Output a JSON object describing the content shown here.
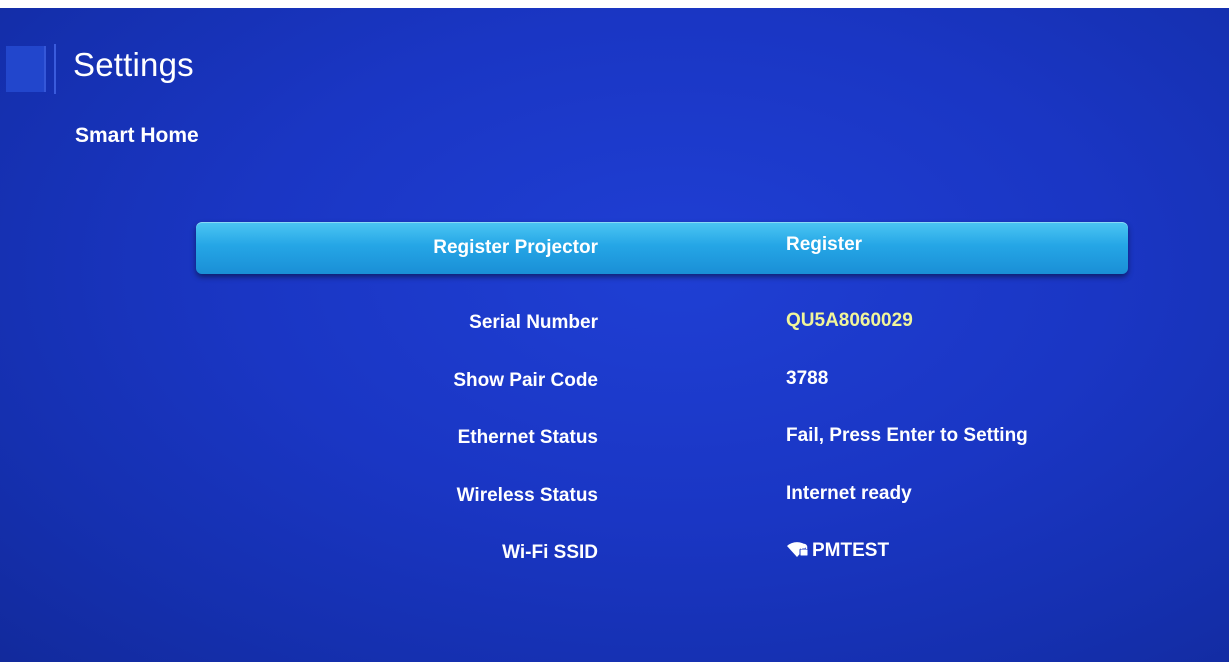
{
  "header": {
    "title": "Settings",
    "subtitle": "Smart Home"
  },
  "rows": [
    {
      "label": "Register Projector",
      "value": "Register",
      "selected": true
    },
    {
      "label": "Serial Number",
      "value": "QU5A8060029"
    },
    {
      "label": "Show Pair Code",
      "value": "3788"
    },
    {
      "label": "Ethernet Status",
      "value": "Fail,  Press Enter to Setting"
    },
    {
      "label": "Wireless Status",
      "value": "Internet ready"
    },
    {
      "label": "Wi-Fi SSID",
      "value": "PMTEST",
      "icon": "wifi-lock-icon"
    }
  ],
  "colors": {
    "background": "#1a36c4",
    "highlight": "#25a6e6",
    "value_text": "#f1f59a",
    "label_text": "#ffffff"
  }
}
